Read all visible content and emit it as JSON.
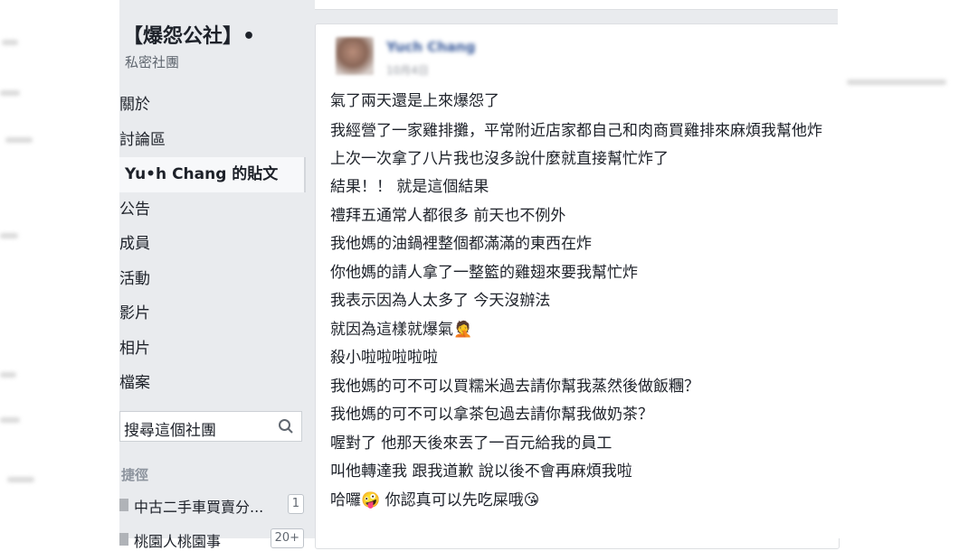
{
  "group": {
    "name": "【爆怨公社】•",
    "type": "私密社團"
  },
  "sidebar": {
    "items": [
      {
        "label": "關於",
        "active": false
      },
      {
        "label": "討論區",
        "active": false
      },
      {
        "label": "Yu•h Chang 的貼文",
        "active": true
      },
      {
        "label": "公告",
        "active": false
      },
      {
        "label": "成員",
        "active": false
      },
      {
        "label": "活動",
        "active": false
      },
      {
        "label": "影片",
        "active": false
      },
      {
        "label": "相片",
        "active": false
      },
      {
        "label": "檔案",
        "active": false
      }
    ],
    "search_label": "搜尋這個社團",
    "shortcuts_heading": "捷徑",
    "shortcuts": [
      {
        "label": "中古二手車買賣分...",
        "count": "1"
      },
      {
        "label": "桃園人桃園事",
        "count": "20+"
      }
    ]
  },
  "post": {
    "author": "Yuch Chang",
    "meta": "10月4日",
    "lines": [
      "氣了兩天還是上來爆怨了",
      "我經營了一家雞排攤，平常附近店家都自己和肉商買雞排來麻煩我幫他炸",
      "上次一次拿了八片我也沒多說什麼就直接幫忙炸了",
      "結果！！ 就是這個結果",
      "禮拜五通常人都很多 前天也不例外",
      "我他媽的油鍋裡整個都滿滿的東西在炸",
      "你他媽的請人拿了一整籃的雞翅來要我幫忙炸",
      "我表示因為人太多了 今天沒辦法",
      "就因為這樣就爆氣🤦",
      "殺小啦啦啦啦啦",
      "我他媽的可不可以買糯米過去請你幫我蒸然後做飯糰？",
      "我他媽的可不可以拿茶包過去請你幫我做奶茶？",
      "喔對了 他那天後來丟了一百元給我的員工",
      "叫他轉達我 跟我道歉 說以後不會再麻煩我啦",
      "哈囉🤪 你認真可以先吃屎哦😘"
    ]
  },
  "colors": {
    "panel_bg": "#e9ebee",
    "text": "#1d2129",
    "secondary": "#606770",
    "link": "#365899"
  }
}
